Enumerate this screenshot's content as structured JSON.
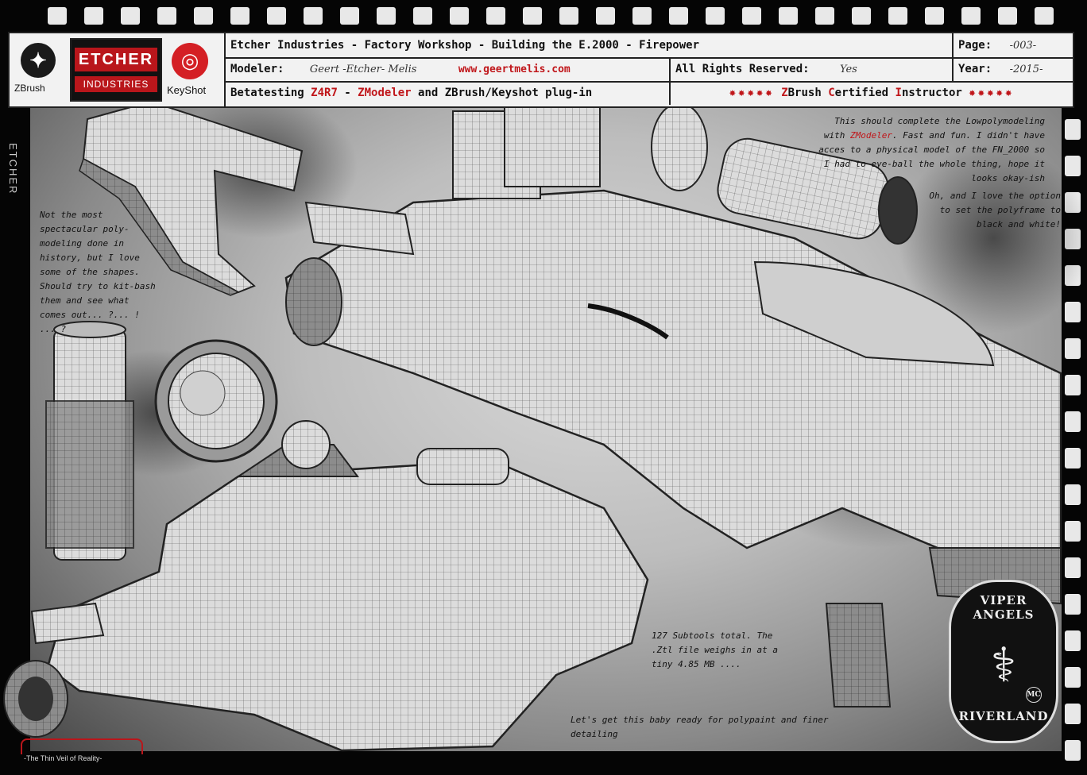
{
  "header": {
    "title": "Etcher Industries - Factory Workshop - Building the E.2000 - Firepower",
    "modeler_label": "Modeler:",
    "modeler_value": "Geert -Etcher- Melis",
    "url": "www.geertmelis.com",
    "rights_label": "All Rights Reserved:",
    "rights_value": "Yes",
    "page_label": "Page:",
    "page_value": "-003-",
    "year_label": "Year:",
    "year_value": "-2015-",
    "betatest_prefix": "Betatesting",
    "betatest_z4r7": "Z4R7",
    "betatest_dash": " - ",
    "betatest_zmodeler": "ZModeler",
    "betatest_suffix": " and ZBrush/Keyshot plug-in",
    "certified_z": "Z",
    "certified_brush": "Brush ",
    "certified_c": "C",
    "certified_ertified": "ertified ",
    "certified_i": "I",
    "certified_nstructor": "nstructor",
    "stars": "✸✸✸✸✸"
  },
  "logos": {
    "zbrush": "ZBrush",
    "etcher_top": "ETCHER",
    "etcher_bottom": "INDUSTRIES",
    "keyshot": "KeyShot",
    "side_label": "ETCHER",
    "bottom_tagline": "-The Thin Veil of Reality-"
  },
  "notes": {
    "left": "Not the most spectacular poly-modeling done in history, but I love some of the shapes. Should try to kit-bash them and see what comes out... ?... ! ... ?",
    "top_right_1": "This should complete the Lowpolymodeling with",
    "top_right_zmodeler": "ZModeler",
    "top_right_2": ". Fast and fun. I didn't have acces to a physical model of the FN_2000 so I had to eye-ball the whole thing, hope it looks okay-ish",
    "right_2": "Oh, and I love the option to set the polyframe to black and white!",
    "subtools": "127 Subtools total. The .Ztl file weighs in at a tiny 4.85 MB ....",
    "bottom": "Let's get this baby ready for polypaint and finer detailing"
  },
  "badge": {
    "top": "VIPER ANGELS",
    "bottom": "RIVERLAND",
    "mc": "MC"
  }
}
